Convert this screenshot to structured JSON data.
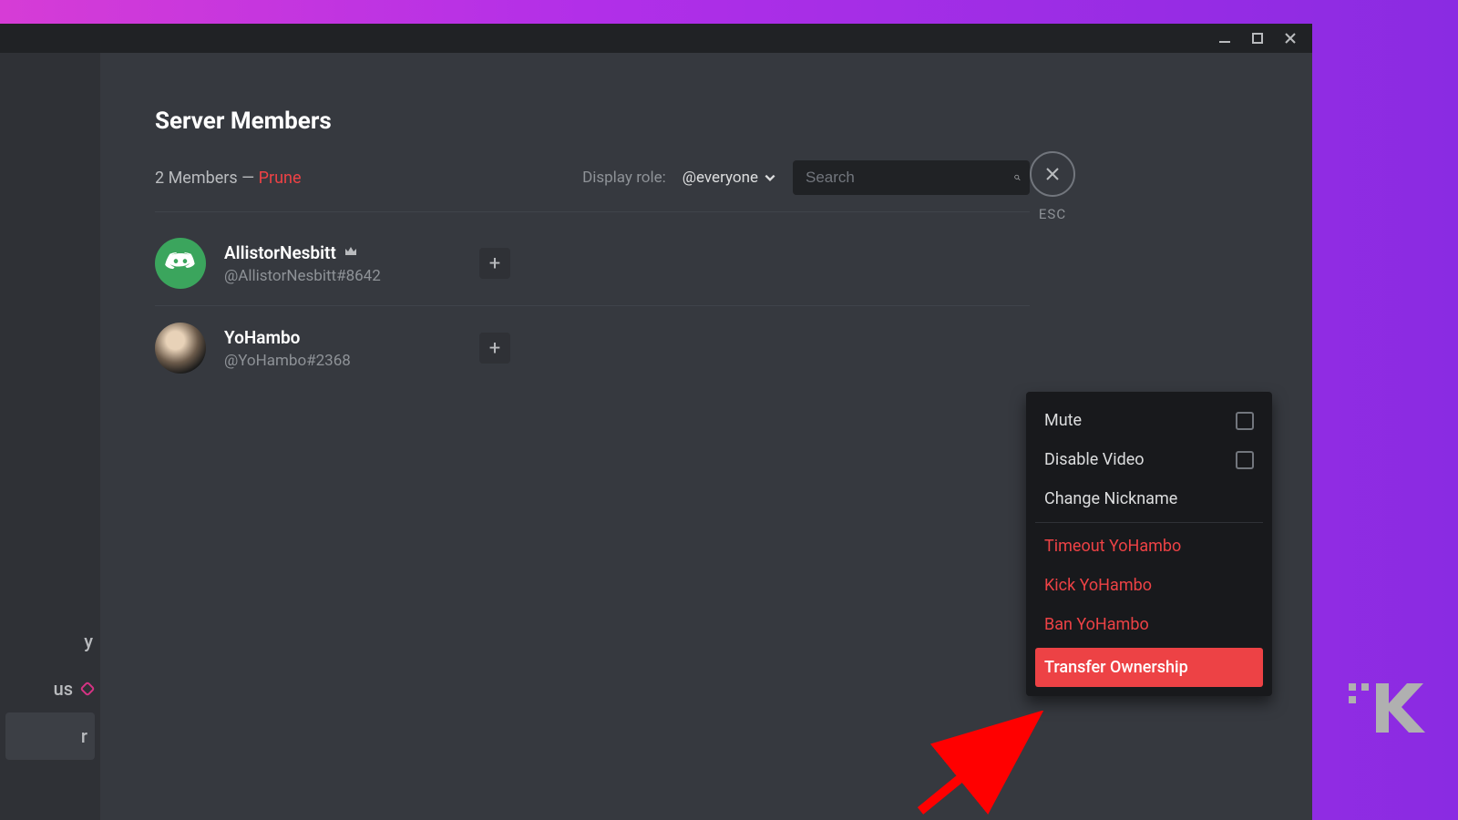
{
  "window": {
    "minimize_tip": "Minimize",
    "maximize_tip": "Maximize",
    "close_tip": "Close"
  },
  "page": {
    "title": "Server Members",
    "member_count_text": "2 Members — ",
    "prune_label": "Prune",
    "display_role_label": "Display role:",
    "role_selected": "@everyone",
    "search_placeholder": "Search",
    "close_hint": "ESC"
  },
  "members": [
    {
      "name": "AllistorNesbitt",
      "handle": "@AllistorNesbitt#8642",
      "owner": true,
      "avatar_kind": "green"
    },
    {
      "name": "YoHambo",
      "handle": "@YoHambo#2368",
      "owner": false,
      "avatar_kind": "photo"
    }
  ],
  "context_menu": {
    "mute": "Mute",
    "disable_video": "Disable Video",
    "change_nickname": "Change Nickname",
    "timeout": "Timeout YoHambo",
    "kick": "Kick YoHambo",
    "ban": "Ban YoHambo",
    "transfer": "Transfer Ownership"
  },
  "sidebar_fragments": {
    "row_y": "y",
    "row_us": "us",
    "row_r": "r"
  },
  "colors": {
    "bg": "#36393f",
    "sidebar": "#2f3136",
    "danger": "#ed4245",
    "panel": "#18191c"
  }
}
